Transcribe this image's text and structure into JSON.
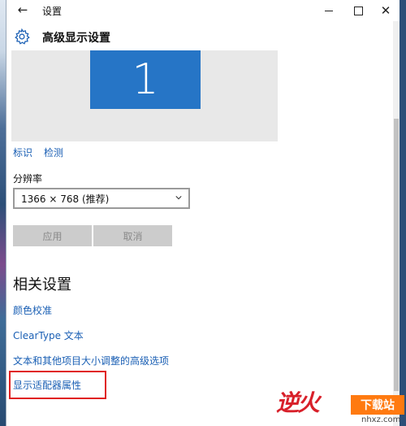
{
  "window": {
    "title": "设置",
    "back_glyph": "←",
    "close_glyph": "✕"
  },
  "header": {
    "title": "高级显示设置",
    "icon": "gear-icon"
  },
  "display_preview": {
    "monitor_number": "1"
  },
  "display_links": {
    "identify": "标识",
    "detect": "检测"
  },
  "resolution": {
    "label": "分辨率",
    "value": "1366 × 768 (推荐)"
  },
  "actions": {
    "apply": "应用",
    "cancel": "取消"
  },
  "related": {
    "title": "相关设置",
    "links": [
      "颜色校准",
      "ClearType 文本",
      "文本和其他项目大小调整的高级选项",
      "显示适配器属性"
    ]
  },
  "watermark": {
    "logo": "逆火",
    "badge": "下载站",
    "url": "nhxz.com"
  },
  "colors": {
    "accent_link": "#1a5fb4",
    "monitor_tile": "#2675c6",
    "highlight_box": "#e02020"
  }
}
